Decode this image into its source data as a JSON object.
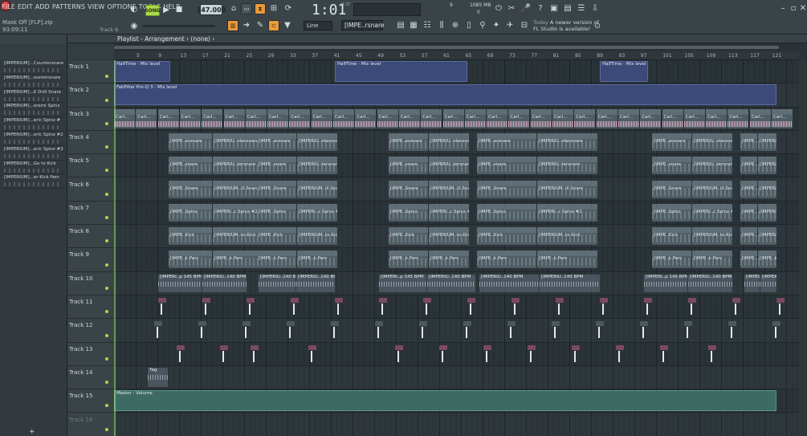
{
  "menu": [
    "FILE",
    "EDIT",
    "ADD",
    "PATTERNS",
    "VIEW",
    "OPTIONS",
    "TOOLS",
    "HELP"
  ],
  "project": {
    "name": "Mask Off [FLP].zip",
    "time": "93:09:11",
    "hint": "Track 6"
  },
  "transport": {
    "mode": "SONG",
    "tempo": "147.000",
    "time": "1:01",
    "time_unit": "B:ST",
    "cpu": "9",
    "memory": "1085 MB",
    "memory_sub": "0"
  },
  "toolbar": {
    "snap": "Line",
    "pattern": "[IMPE..rsnare"
  },
  "news": {
    "today": "Today",
    "line1": "A newer version of",
    "line2": "FL Studio is available!"
  },
  "playlist": {
    "title": "Playlist - Arrangement",
    "arrangement": "(none)"
  },
  "browser_items": [
    "[IMPERIUM]...Countersnare",
    "[IMPERIUM]...ountersnare",
    "[IMPERIUM]...K Drill Snare",
    "[IMPERIUM]...eremi Spinz",
    "[IMPERIUM]...eric Spinz #",
    "[IMPERIUM]...eric Spinz #2",
    "[IMPERIUM]...eric Spinz #3",
    "[IMPERIUM]...Go to Kick",
    "[IMPERIUM]...er Kick Perc"
  ],
  "ruler": [
    "5",
    "9",
    "13",
    "17",
    "21",
    "25",
    "29",
    "33",
    "37",
    "41",
    "45",
    "49",
    "53",
    "57",
    "61",
    "65",
    "69",
    "73",
    "77",
    "81",
    "85",
    "89",
    "93",
    "97",
    "101",
    "105",
    "109",
    "113",
    "117",
    "121"
  ],
  "tracks": [
    "Track 1",
    "Track 2",
    "Track 3",
    "Track 4",
    "Track 5",
    "Track 6",
    "Track 7",
    "Track 8",
    "Track 9",
    "Track 10",
    "Track 11",
    "Track 12",
    "Track 13",
    "Track 14",
    "Track 15",
    "Track 16"
  ],
  "clip_labels": {
    "halftime": "HalfTime - Mix level",
    "fabfilter": "FabFilter Pro-Q 3 - Mix level",
    "carl": "Carl...",
    "t4": "[IMPE..ersnare",
    "t4b": "[IMPERIU..ntersnare",
    "t5": "[IMPE..snare",
    "t5b": "[IMPERIU..tersnare",
    "t6": "[IMPE..Snare",
    "t6b": "[IMPERIUM..ill Snare",
    "t7": "[IMPE..Spinz",
    "t7b": "[IMPERI..c Spinz #2",
    "t8": "[IMPE..Kick",
    "t8b": "[IMPERIUM..to Kick",
    "t9": "[IMPE..k Perc",
    "t10": "[IMPERI..p 145 BPM",
    "t10b": "[IMPERIU..140 BPM",
    "t14": "Tag",
    "master": "Master - Volume"
  },
  "colors": {
    "accent": "#a8d84e",
    "record": "#e04848"
  }
}
